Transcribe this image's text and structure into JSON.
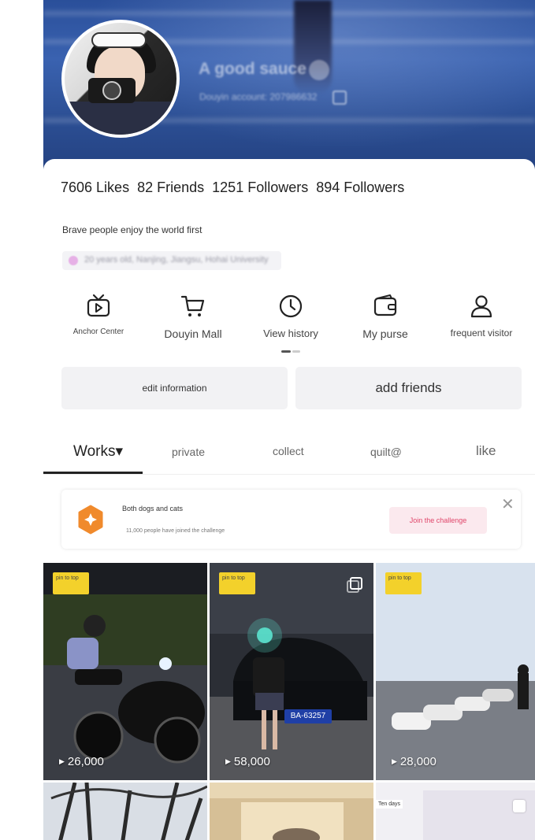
{
  "profile": {
    "nickname": "A good sauce",
    "account": "Douyin account: 207986632"
  },
  "stats": {
    "likes": "7606 Likes",
    "friends": "82 Friends",
    "followers": "1251 Followers",
    "following": "894 Followers"
  },
  "bio": "Brave people enjoy the world first",
  "meta": "20 years old, Nanjing, Jiangsu, Hohai University",
  "shortcuts": [
    {
      "label": "Anchor Center",
      "icon": "tv-play-icon"
    },
    {
      "label": "Douyin Mall",
      "icon": "shopping-cart-icon"
    },
    {
      "label": "View history",
      "icon": "clock-icon"
    },
    {
      "label": "My purse",
      "icon": "wallet-icon"
    },
    {
      "label": "frequent visitor",
      "icon": "user-icon"
    }
  ],
  "actions": {
    "edit": "edit information",
    "add_friends": "add friends"
  },
  "tabs": [
    {
      "label": "Works▾",
      "active": true
    },
    {
      "label": "private",
      "active": false
    },
    {
      "label": "collect",
      "active": false
    },
    {
      "label": "quilt@",
      "active": false
    },
    {
      "label": "like",
      "active": false
    }
  ],
  "challenge": {
    "title": "Both dogs and cats",
    "subtitle": "11,000 people have joined the challenge",
    "button": "Join the challenge"
  },
  "videos": [
    {
      "pin": "pin to top",
      "views": "26,000"
    },
    {
      "pin": "pin to top",
      "views": "58,000",
      "plate": "BA-63257"
    },
    {
      "pin": "pin to top",
      "views": "28,000"
    },
    {
      "views": ""
    },
    {
      "views": ""
    },
    {
      "badge": "Ten days"
    }
  ],
  "colors": {
    "accent": "#e0466a",
    "pin": "#f3d12b",
    "challenge_icon": "#f08a2c"
  }
}
